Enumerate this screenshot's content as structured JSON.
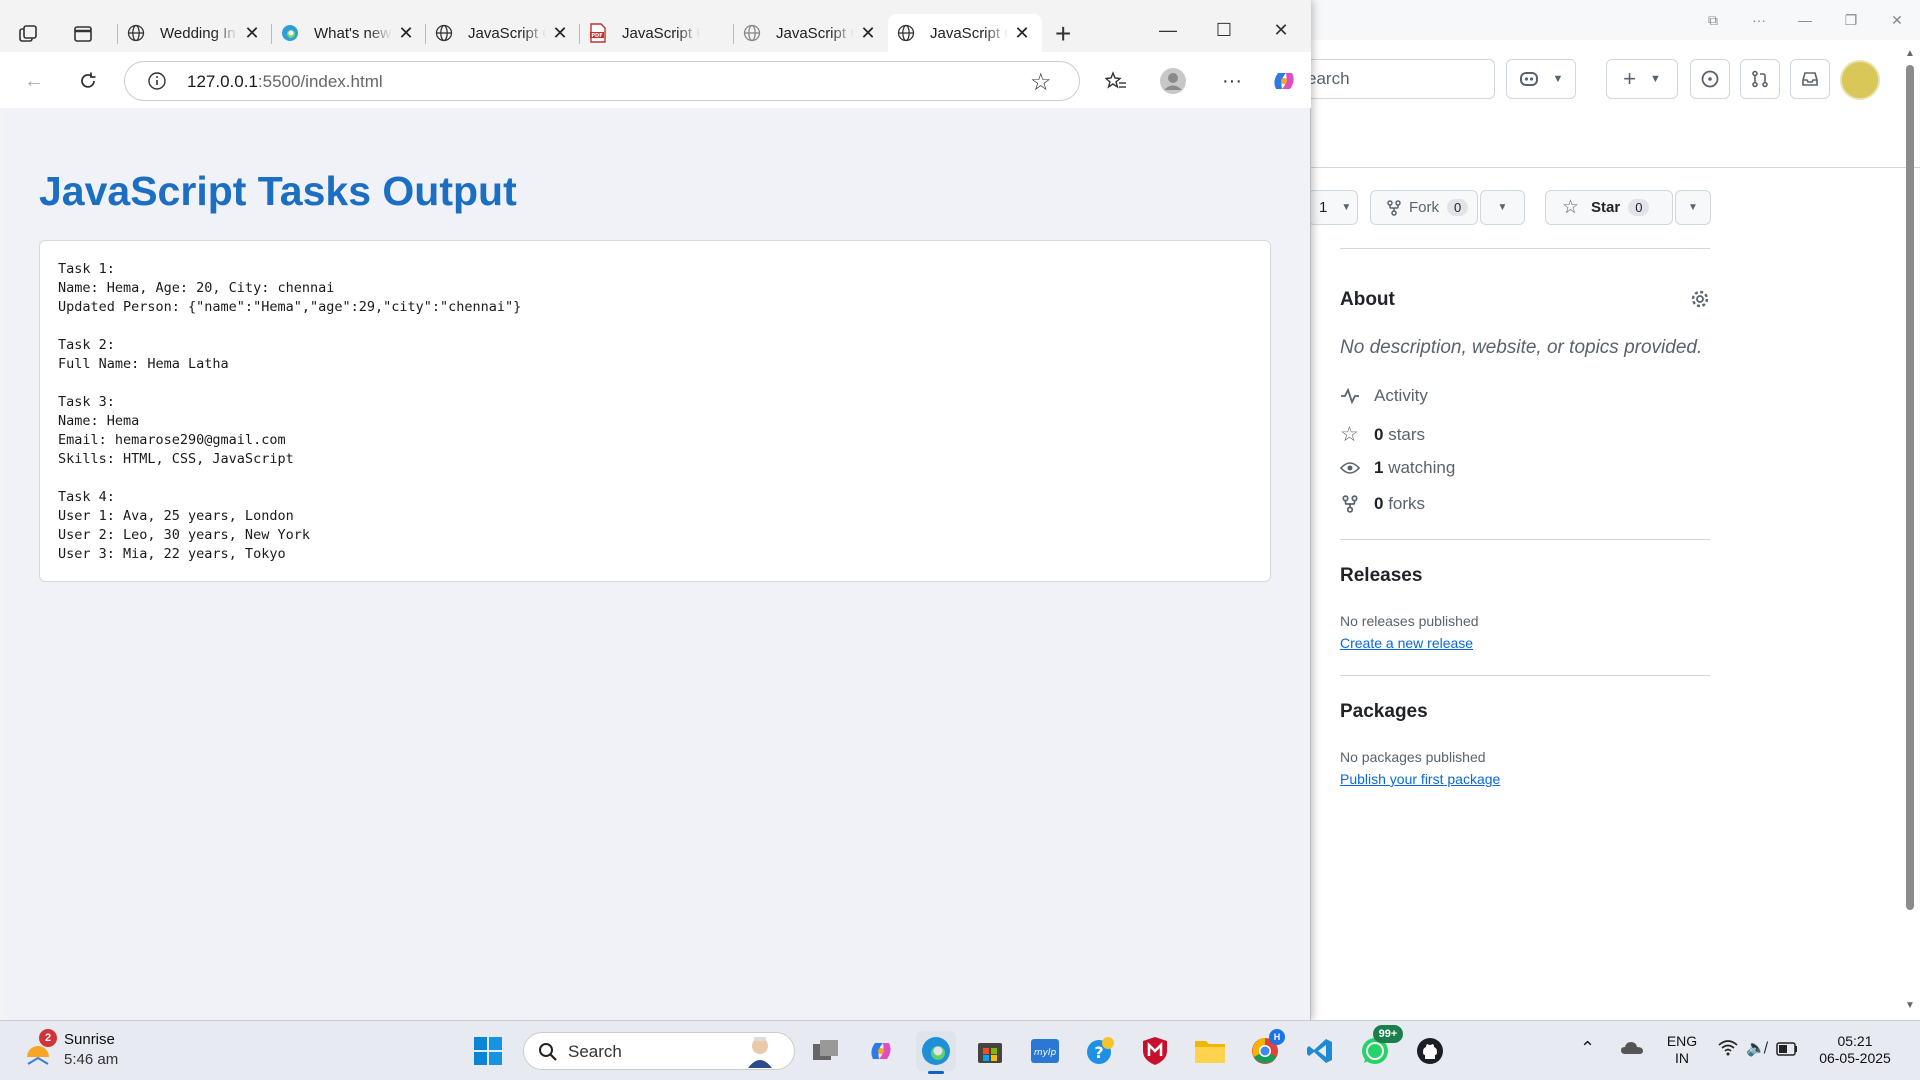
{
  "browser": {
    "tabs": [
      {
        "title": "Wedding In",
        "icon": "globe-icon"
      },
      {
        "title": "What's new",
        "icon": "edge-icon"
      },
      {
        "title": "JavaScript C",
        "icon": "globe-icon"
      },
      {
        "title": "JavaScript U",
        "icon": "pdf-icon"
      },
      {
        "title": "JavaScript C",
        "icon": "globe-icon"
      },
      {
        "title": "JavaScript C",
        "icon": "globe-icon"
      }
    ],
    "address": {
      "host": "127.0.0.1",
      "rest": ":5500/index.html"
    }
  },
  "page": {
    "title": "JavaScript Tasks Output",
    "output_lines": [
      "Task 1:",
      "Name: Hema, Age: 20, City: chennai",
      "Updated Person: {\"name\":\"Hema\",\"age\":29,\"city\":\"chennai\"}",
      "",
      "Task 2:",
      "Full Name: Hema Latha",
      "",
      "Task 3:",
      "Name: Hema",
      "Email: hemarose290@gmail.com",
      "Skills: HTML, CSS, JavaScript",
      "",
      "Task 4:",
      "User 1: Ava, 25 years, London",
      "User 2: Leo, 30 years, New York",
      "User 3: Mia, 22 years, Tokyo"
    ]
  },
  "github": {
    "search_text": "earch",
    "watch_count": "1",
    "fork": {
      "label": "Fork",
      "count": "0"
    },
    "star": {
      "label": "Star",
      "count": "0"
    },
    "about": {
      "heading": "About",
      "description": "No description, website, or topics provided.",
      "activity": "Activity",
      "stars": {
        "n": "0",
        "label": "stars"
      },
      "watching": {
        "n": "1",
        "label": "watching"
      },
      "forks": {
        "n": "0",
        "label": "forks"
      }
    },
    "releases": {
      "heading": "Releases",
      "status": "No releases published",
      "link": "Create a new release"
    },
    "packages": {
      "heading": "Packages",
      "status": "No packages published",
      "link": "Publish your first package"
    }
  },
  "taskbar": {
    "weather": {
      "title": "Sunrise",
      "time": "5:46 am",
      "badge": "2"
    },
    "search_label": "Search",
    "lang": {
      "l1": "ENG",
      "l2": "IN"
    },
    "clock": {
      "time": "05:21",
      "date": "06-05-2025"
    },
    "whatsapp_badge": "99+",
    "chrome_badge": "H"
  },
  "colors": {
    "accent": "#1b6ec2",
    "github_link": "#0969da",
    "page_bg": "#f0f2f7"
  }
}
